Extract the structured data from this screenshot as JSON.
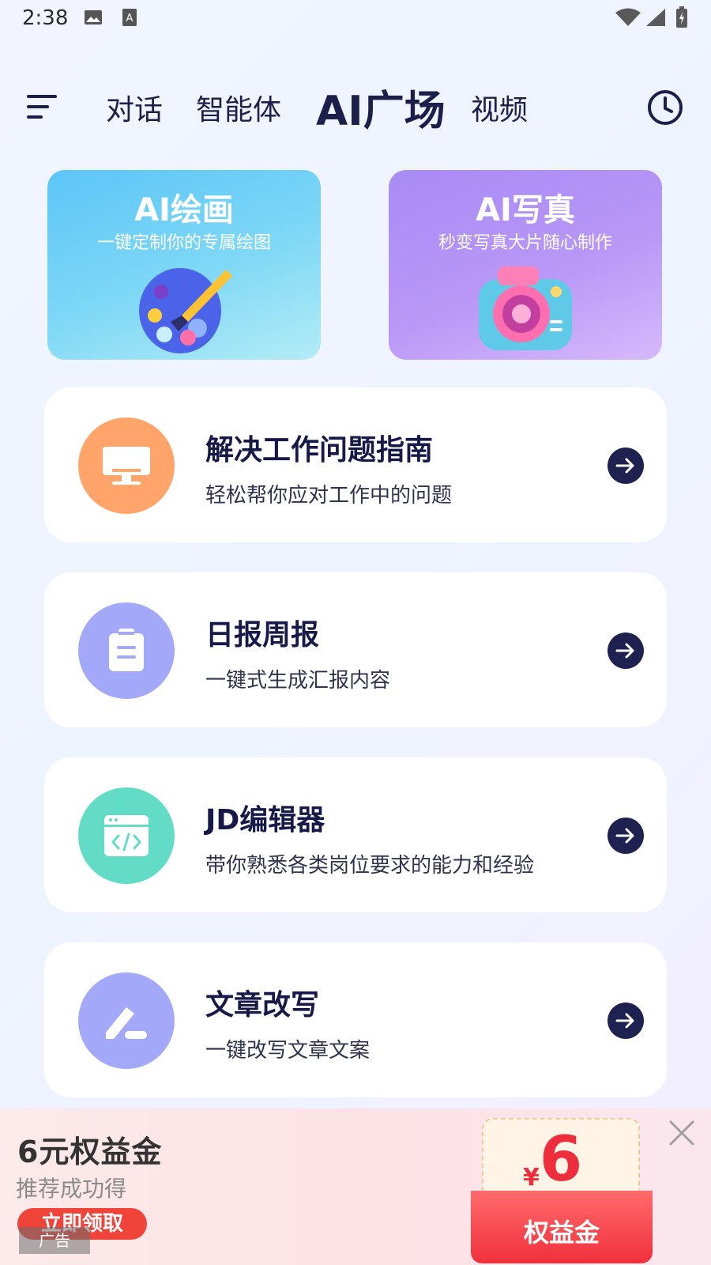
{
  "status_bar": {
    "time": "2:38"
  },
  "header": {
    "tabs": [
      {
        "label": "对话",
        "active": false
      },
      {
        "label": "智能体",
        "active": false
      },
      {
        "label": "AI广场",
        "active": true
      },
      {
        "label": "视频",
        "active": false
      }
    ]
  },
  "banners": [
    {
      "title": "AI绘画",
      "subtitle": "一键定制你的专属绘图",
      "icon": "palette-icon"
    },
    {
      "title": "AI写真",
      "subtitle": "秒变写真大片随心制作",
      "icon": "camera-icon"
    }
  ],
  "cards": [
    {
      "title": "解决工作问题指南",
      "desc": "轻松帮你应对工作中的问题",
      "icon": "monitor-icon",
      "color": "#ffa56b"
    },
    {
      "title": "日报周报",
      "desc": "一键式生成汇报内容",
      "icon": "clipboard-icon",
      "color": "#a4a8f8"
    },
    {
      "title": "JD编辑器",
      "desc": "带你熟悉各类岗位要求的能力和经验",
      "icon": "code-window-icon",
      "color": "#62dcc7"
    },
    {
      "title": "文章改写",
      "desc": "一键改写文章文案",
      "icon": "pen-icon",
      "color": "#a4a8f8"
    }
  ],
  "ad": {
    "title": "6元权益金",
    "subtitle": "推荐成功得",
    "button": "立即领取",
    "tag": "广告",
    "voucher_currency": "¥",
    "voucher_amount": "6",
    "voucher_label": "权益金"
  }
}
